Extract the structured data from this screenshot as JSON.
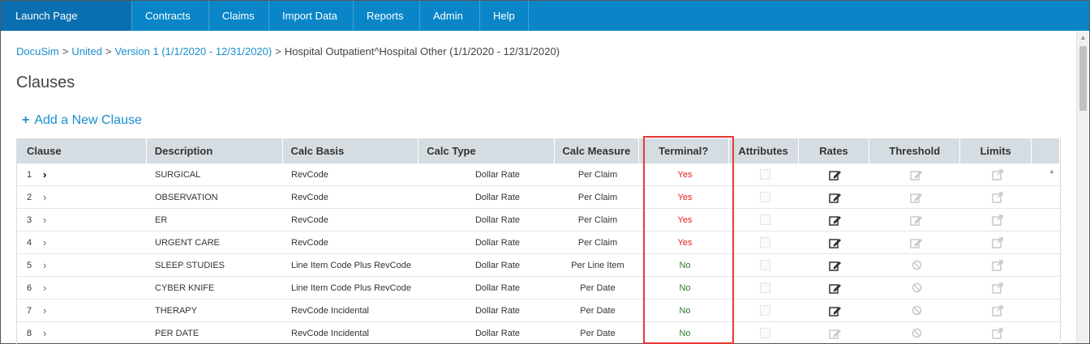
{
  "nav": {
    "items": [
      {
        "label": "Launch Page",
        "key": "launch"
      },
      {
        "label": "Contracts",
        "key": "contracts"
      },
      {
        "label": "Claims",
        "key": "claims"
      },
      {
        "label": "Import Data",
        "key": "import"
      },
      {
        "label": "Reports",
        "key": "reports"
      },
      {
        "label": "Admin",
        "key": "admin"
      },
      {
        "label": "Help",
        "key": "help"
      }
    ]
  },
  "breadcrumb": {
    "links": [
      "DocuSim",
      "United",
      "Version 1 (1/1/2020 - 12/31/2020)"
    ],
    "separator": ">",
    "current": "Hospital Outpatient^Hospital Other (1/1/2020 - 12/31/2020)"
  },
  "page": {
    "title": "Clauses",
    "add_label": "Add a New Clause",
    "add_symbol": "+"
  },
  "table": {
    "columns": [
      "Clause",
      "Description",
      "Calc Basis",
      "Calc Type",
      "Calc Measure",
      "Terminal?",
      "Attributes",
      "Rates",
      "Threshold",
      "Limits"
    ],
    "rows": [
      {
        "num": "1",
        "description": "SURGICAL",
        "basis": "RevCode",
        "type": "Dollar Rate",
        "measure": "Per Claim",
        "terminal": "Yes",
        "threshold": "edit-disabled",
        "rates_active": true,
        "limits_active": false
      },
      {
        "num": "2",
        "description": "OBSERVATION",
        "basis": "RevCode",
        "type": "Dollar Rate",
        "measure": "Per Claim",
        "terminal": "Yes",
        "threshold": "edit-disabled",
        "rates_active": true,
        "limits_active": false
      },
      {
        "num": "3",
        "description": "ER",
        "basis": "RevCode",
        "type": "Dollar Rate",
        "measure": "Per Claim",
        "terminal": "Yes",
        "threshold": "edit-disabled",
        "rates_active": true,
        "limits_active": false
      },
      {
        "num": "4",
        "description": "URGENT CARE",
        "basis": "RevCode",
        "type": "Dollar Rate",
        "measure": "Per Claim",
        "terminal": "Yes",
        "threshold": "edit-disabled",
        "rates_active": true,
        "limits_active": false
      },
      {
        "num": "5",
        "description": "SLEEP STUDIES",
        "basis": "Line Item Code Plus RevCode",
        "type": "Dollar Rate",
        "measure": "Per Line Item",
        "terminal": "No",
        "threshold": "ban",
        "rates_active": true,
        "limits_active": false
      },
      {
        "num": "6",
        "description": "CYBER KNIFE",
        "basis": "Line Item Code Plus RevCode",
        "type": "Dollar Rate",
        "measure": "Per Date",
        "terminal": "No",
        "threshold": "ban",
        "rates_active": true,
        "limits_active": false
      },
      {
        "num": "7",
        "description": "THERAPY",
        "basis": "RevCode Incidental",
        "type": "Dollar Rate",
        "measure": "Per Date",
        "terminal": "No",
        "threshold": "ban",
        "rates_active": true,
        "limits_active": false
      },
      {
        "num": "8",
        "description": "PER DATE",
        "basis": "RevCode Incidental",
        "type": "Dollar Rate",
        "measure": "Per Date",
        "terminal": "No",
        "threshold": "ban",
        "rates_active": false,
        "limits_active": false
      }
    ]
  },
  "icons": {
    "chevron": "chevron-right-icon",
    "rates": "edit-icon",
    "threshold_edit": "edit-icon",
    "threshold_ban": "ban-icon",
    "limits": "external-link-icon"
  },
  "colors": {
    "nav_bg": "#0a86c8",
    "launch_bg": "#0a6fb0",
    "link": "#1a8fd0",
    "yes": "#e0201b",
    "no": "#2b7a2b",
    "header_bg": "#d6dde2",
    "highlight": "#e53935"
  }
}
